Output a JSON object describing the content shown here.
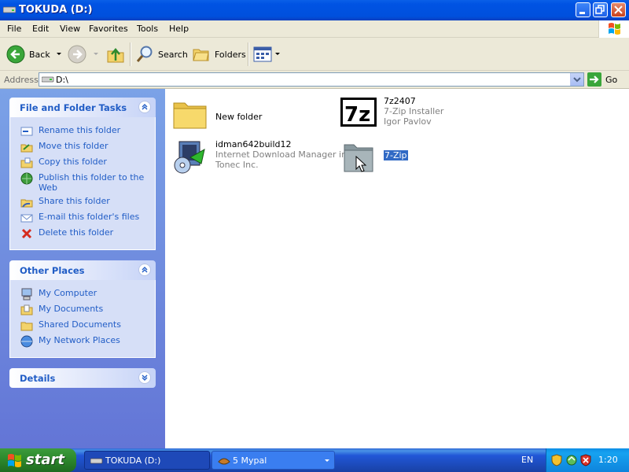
{
  "window": {
    "title": "TOKUDA (D:)"
  },
  "menu": [
    "File",
    "Edit",
    "View",
    "Favorites",
    "Tools",
    "Help"
  ],
  "toolbar": {
    "back": "Back",
    "search": "Search",
    "folders": "Folders"
  },
  "address": {
    "label": "Address",
    "value": "D:\\",
    "go": "Go"
  },
  "file_tasks": {
    "title": "File and Folder Tasks",
    "items": [
      "Rename this folder",
      "Move this folder",
      "Copy this folder",
      "Publish this folder to the Web",
      "Share this folder",
      "E-mail this folder's files",
      "Delete this folder"
    ]
  },
  "other_places": {
    "title": "Other Places",
    "items": [
      "My Computer",
      "My Documents",
      "Shared Documents",
      "My Network Places"
    ]
  },
  "details": {
    "title": "Details"
  },
  "files": [
    {
      "name": "New folder"
    },
    {
      "name": "7z2407",
      "line2": "7-Zip Installer",
      "line3": "Igor Pavlov"
    },
    {
      "name": "idman642build12",
      "line2": "Internet Download Manager in...",
      "line3": "Tonec Inc."
    },
    {
      "name": "7-Zip"
    }
  ],
  "taskbar": {
    "start": "start",
    "tasks": [
      "TOKUDA (D:)",
      "5 Mypal"
    ],
    "lang": "EN",
    "clock": "1:20"
  },
  "colors": {
    "title_blue": "#0053e3",
    "link_blue": "#215dc6",
    "selection": "#316ac5",
    "start_green": "#2e8b2e"
  }
}
